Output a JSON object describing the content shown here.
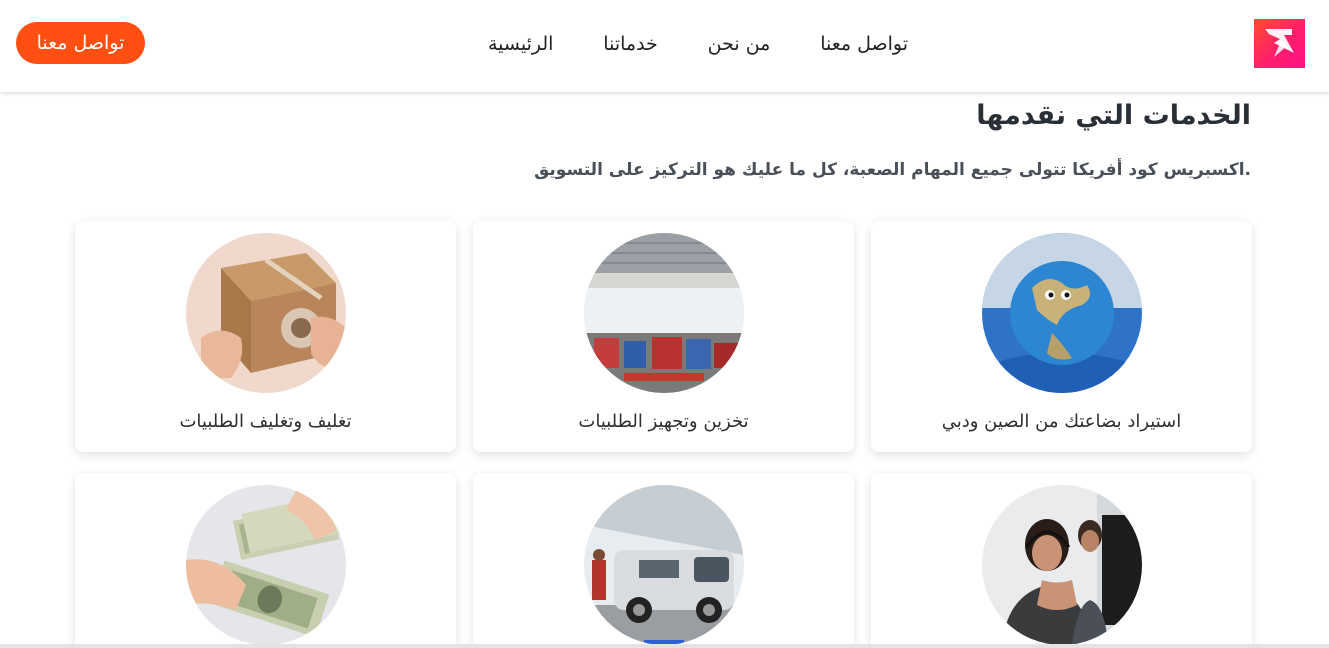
{
  "nav": {
    "links": [
      "الرئيسية",
      "خدماتنا",
      "من نحن",
      "تواصل معنا"
    ],
    "cta_label": "تواصل معنا"
  },
  "section": {
    "title": "الخدمات التي نقدمها",
    "subtitle": ".اكسبريس كود أفريكا تتولى جميع المهام الصعبة، كل ما عليك هو التركيز على التسويق"
  },
  "services": [
    {
      "label": "استيراد بضاعتك من الصين ودبي",
      "image": "globe-image"
    },
    {
      "label": "تخزين وتجهيز الطلبيات",
      "image": "warehouse-image"
    },
    {
      "label": "تغليف وتغليف الطلبيات",
      "image": "package-image"
    },
    {
      "label": "",
      "image": "call-center-image"
    },
    {
      "label": "",
      "image": "delivery-van-image"
    },
    {
      "label": "",
      "image": "cash-image"
    }
  ],
  "colors": {
    "accent": "#ff4f12",
    "logo_gradient_start": "#ff4d2d",
    "logo_gradient_end": "#ff0f86",
    "title": "#2a2f36"
  }
}
